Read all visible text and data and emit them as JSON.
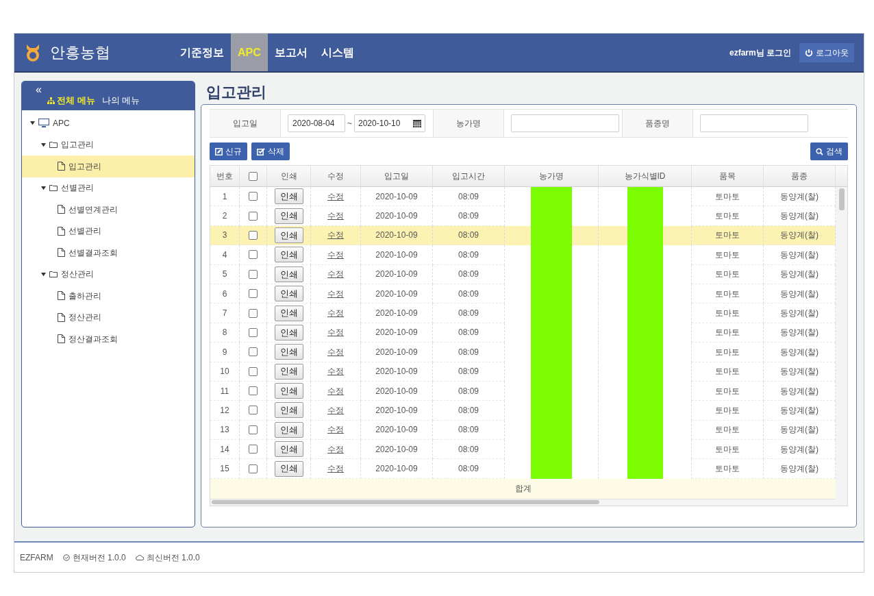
{
  "header": {
    "logo": "안흥농협",
    "nav": [
      {
        "label": "기준정보",
        "selected": false
      },
      {
        "label": "APC",
        "selected": true
      },
      {
        "label": "보고서",
        "selected": false
      },
      {
        "label": "시스템",
        "selected": false
      }
    ],
    "user": "ezfarm님 로그인",
    "logout": "로그아웃"
  },
  "sidebar": {
    "collapse": "«",
    "tabs": [
      {
        "label": "전체 메뉴",
        "selected": true
      },
      {
        "label": "나의 메뉴",
        "selected": false
      }
    ],
    "tree": [
      {
        "label": "APC",
        "kind": "root",
        "expanded": true,
        "selected": false,
        "children": [
          {
            "label": "입고관리",
            "kind": "folder",
            "expanded": true,
            "selected": false,
            "children": [
              {
                "label": "입고관리",
                "kind": "page",
                "selected": true
              }
            ]
          },
          {
            "label": "선별관리",
            "kind": "folder",
            "expanded": true,
            "selected": false,
            "children": [
              {
                "label": "선별연계관리",
                "kind": "page",
                "selected": false
              },
              {
                "label": "선별관리",
                "kind": "page",
                "selected": false
              },
              {
                "label": "선별결과조회",
                "kind": "page",
                "selected": false
              }
            ]
          },
          {
            "label": "정산관리",
            "kind": "folder",
            "expanded": true,
            "selected": false,
            "children": [
              {
                "label": "출하관리",
                "kind": "page",
                "selected": false
              },
              {
                "label": "정산관리",
                "kind": "page",
                "selected": false
              },
              {
                "label": "정산결과조회",
                "kind": "page",
                "selected": false
              }
            ]
          }
        ]
      }
    ]
  },
  "page_title": "입고관리",
  "filter": {
    "date_label": "입고일",
    "date_from": "2020-08-04",
    "date_sep": "~",
    "date_to": "2020-10-10",
    "farm_label": "농가명",
    "variety_label": "품종명"
  },
  "buttons": {
    "new": "신규",
    "delete": "삭제",
    "search": "검색"
  },
  "table": {
    "columns": [
      {
        "label": "번호"
      },
      {
        "kind": "checkbox",
        "checked": false
      },
      {
        "label": "인쇄"
      },
      {
        "label": "수정"
      },
      {
        "label": "입고일"
      },
      {
        "label": "입고시간"
      },
      {
        "label": "농가명",
        "redacted": true
      },
      {
        "label": "농가식별ID",
        "redacted": true
      },
      {
        "label": "품목"
      },
      {
        "label": "품종"
      }
    ],
    "rows": [
      {
        "no": "1",
        "checked": false,
        "print": "인쇄",
        "edit": "수정",
        "date": "2020-10-09",
        "time": "08:09",
        "item": "토마토",
        "variety": "동양계(찰)",
        "selected": false
      },
      {
        "no": "2",
        "checked": false,
        "print": "인쇄",
        "edit": "수정",
        "date": "2020-10-09",
        "time": "08:09",
        "item": "토마토",
        "variety": "동양계(찰)",
        "selected": false
      },
      {
        "no": "3",
        "checked": false,
        "print": "인쇄",
        "edit": "수정",
        "date": "2020-10-09",
        "time": "08:09",
        "item": "토마토",
        "variety": "동양계(찰)",
        "selected": true
      },
      {
        "no": "4",
        "checked": false,
        "print": "인쇄",
        "edit": "수정",
        "date": "2020-10-09",
        "time": "08:09",
        "item": "토마토",
        "variety": "동양계(찰)",
        "selected": false
      },
      {
        "no": "5",
        "checked": false,
        "print": "인쇄",
        "edit": "수정",
        "date": "2020-10-09",
        "time": "08:09",
        "item": "토마토",
        "variety": "동양계(찰)",
        "selected": false
      },
      {
        "no": "6",
        "checked": false,
        "print": "인쇄",
        "edit": "수정",
        "date": "2020-10-09",
        "time": "08:09",
        "item": "토마토",
        "variety": "동양계(찰)",
        "selected": false
      },
      {
        "no": "7",
        "checked": false,
        "print": "인쇄",
        "edit": "수정",
        "date": "2020-10-09",
        "time": "08:09",
        "item": "토마토",
        "variety": "동양계(찰)",
        "selected": false
      },
      {
        "no": "8",
        "checked": false,
        "print": "인쇄",
        "edit": "수정",
        "date": "2020-10-09",
        "time": "08:09",
        "item": "토마토",
        "variety": "동양계(찰)",
        "selected": false
      },
      {
        "no": "9",
        "checked": false,
        "print": "인쇄",
        "edit": "수정",
        "date": "2020-10-09",
        "time": "08:09",
        "item": "토마토",
        "variety": "동양계(찰)",
        "selected": false
      },
      {
        "no": "10",
        "checked": false,
        "print": "인쇄",
        "edit": "수정",
        "date": "2020-10-09",
        "time": "08:09",
        "item": "토마토",
        "variety": "동양계(찰)",
        "selected": false
      },
      {
        "no": "11",
        "checked": false,
        "print": "인쇄",
        "edit": "수정",
        "date": "2020-10-09",
        "time": "08:09",
        "item": "토마토",
        "variety": "동양계(찰)",
        "selected": false
      },
      {
        "no": "12",
        "checked": false,
        "print": "인쇄",
        "edit": "수정",
        "date": "2020-10-09",
        "time": "08:09",
        "item": "토마토",
        "variety": "동양계(찰)",
        "selected": false
      },
      {
        "no": "13",
        "checked": false,
        "print": "인쇄",
        "edit": "수정",
        "date": "2020-10-09",
        "time": "08:09",
        "item": "토마토",
        "variety": "동양계(찰)",
        "selected": false
      },
      {
        "no": "14",
        "checked": false,
        "print": "인쇄",
        "edit": "수정",
        "date": "2020-10-09",
        "time": "08:09",
        "item": "토마토",
        "variety": "동양계(찰)",
        "selected": false
      },
      {
        "no": "15",
        "checked": false,
        "print": "인쇄",
        "edit": "수정",
        "date": "2020-10-09",
        "time": "08:09",
        "item": "토마토",
        "variety": "동양계(찰)",
        "selected": false
      }
    ],
    "total": "합계"
  },
  "footer": {
    "brand": "EZFARM",
    "current": "현재버전 1.0.0",
    "latest": "최신버전 1.0.0"
  }
}
